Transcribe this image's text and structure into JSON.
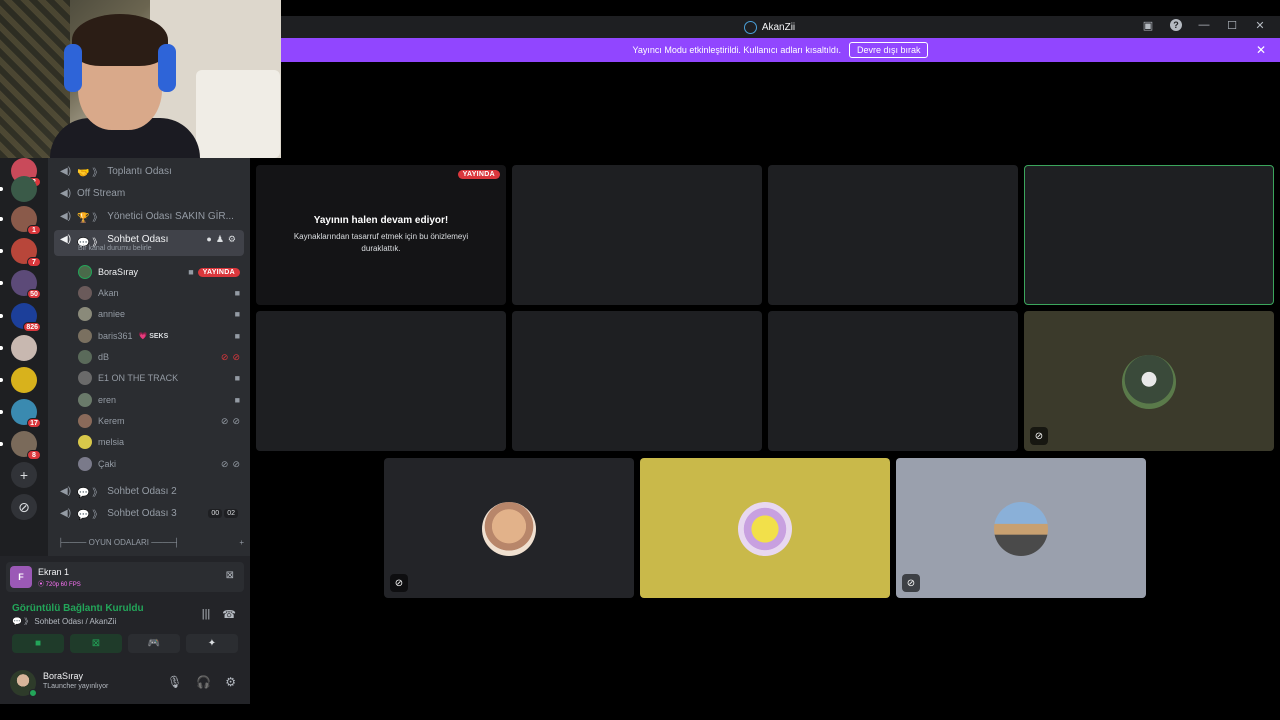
{
  "window": {
    "title": "AkanZii"
  },
  "notice": {
    "text": "Yayıncı Modu etkinleştirildi. Kullanıcı adları kısaltıldı.",
    "button": "Devre dışı bırak",
    "color": "#9146ff"
  },
  "guilds": {
    "badges": [
      "2",
      "1",
      "7",
      "50",
      "826",
      "17",
      "8"
    ]
  },
  "channels": {
    "items": [
      {
        "label": "Toplantı Odası",
        "prefix": "🤝 》"
      },
      {
        "label": "Off Stream",
        "prefix": ""
      },
      {
        "label": "Yönetici Odası SAKIN GİR...",
        "prefix": "🏆 》"
      },
      {
        "label": "Sohbet Odası",
        "prefix": "💬 》",
        "status": "Bir kanal durumu belirle"
      },
      {
        "label": "Sohbet Odası 2",
        "prefix": "💬 》"
      },
      {
        "label": "Sohbet Odası 3",
        "prefix": "💬 》",
        "counts": [
          "00",
          "02"
        ]
      }
    ],
    "users": [
      {
        "name": "BoraSıray",
        "badge": "YAYINDA"
      },
      {
        "name": "Akan"
      },
      {
        "name": "anniee"
      },
      {
        "name": "baris361",
        "tag": "💗 SEKS"
      },
      {
        "name": "dB"
      },
      {
        "name": "E1 ON THE TRACK"
      },
      {
        "name": "eren"
      },
      {
        "name": "Kerem"
      },
      {
        "name": "melsia"
      },
      {
        "name": "Çaki"
      }
    ],
    "category": "├──── OYUN ODALARI ────┤"
  },
  "stream": {
    "name": "Ekran 1",
    "quality": "⦿ 720p 60 FPS"
  },
  "voice": {
    "status": "Görüntülü Bağlantı Kuruldu",
    "location": "💬 》 Sohbet Odası / AkanZii"
  },
  "me": {
    "name": "BoraSıray",
    "activity": "TLauncher yayınlıyor"
  },
  "grid": {
    "live_label": "YAYINDA",
    "paused_title": "Yayının halen devam ediyor!",
    "paused_text": "Kaynaklarından tasarruf etmek için bu önizlemeyi duraklattık."
  },
  "colors": {
    "live": "#da373c",
    "connected": "#23a559",
    "highlight": "#3ba55c"
  }
}
